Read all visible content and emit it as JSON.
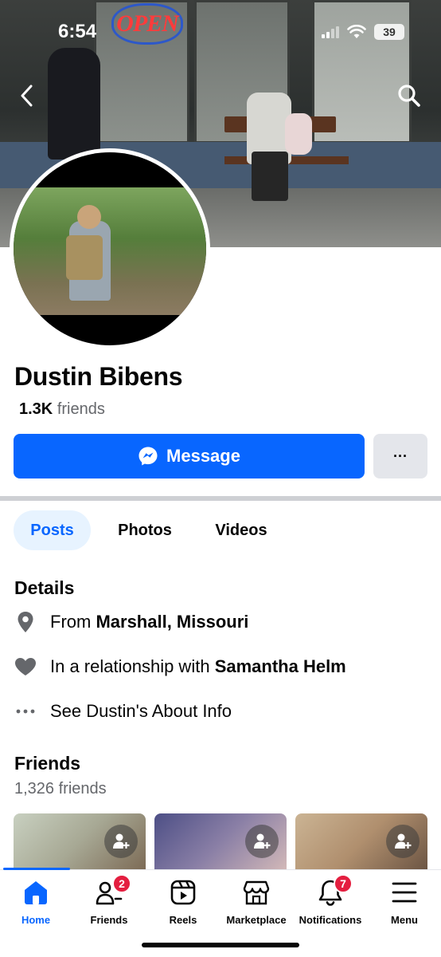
{
  "status_bar": {
    "time": "6:54",
    "battery": "39"
  },
  "cover": {
    "sign_text": "OPEN"
  },
  "profile": {
    "name": "Dustin Bibens",
    "friends_count": "1.3K",
    "friends_word": "friends",
    "message_label": "Message",
    "more_label": "···"
  },
  "tabs": [
    {
      "label": "Posts",
      "active": true
    },
    {
      "label": "Photos",
      "active": false
    },
    {
      "label": "Videos",
      "active": false
    }
  ],
  "details": {
    "title": "Details",
    "from_prefix": "From",
    "from_value": "Marshall, Missouri",
    "relationship_prefix": "In a relationship with",
    "relationship_value": "Samantha Helm",
    "about_label": "See Dustin's About Info"
  },
  "friends_section": {
    "title": "Friends",
    "subtitle": "1,326 friends"
  },
  "bottom_nav": [
    {
      "label": "Home",
      "icon": "home-icon",
      "active": true
    },
    {
      "label": "Friends",
      "icon": "friends-icon",
      "badge": "2"
    },
    {
      "label": "Reels",
      "icon": "reels-icon"
    },
    {
      "label": "Marketplace",
      "icon": "marketplace-icon"
    },
    {
      "label": "Notifications",
      "icon": "bell-icon",
      "badge": "7"
    },
    {
      "label": "Menu",
      "icon": "menu-icon"
    }
  ],
  "colors": {
    "accent": "#0866ff",
    "badge": "#e41e3f",
    "secondary_text": "#65676b"
  }
}
